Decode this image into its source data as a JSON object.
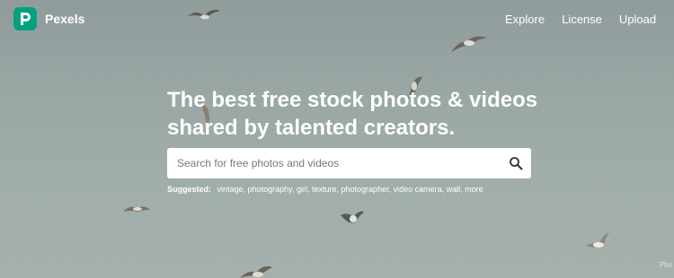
{
  "brand": {
    "name": "Pexels",
    "logo_letter_icon": "pexels-p-icon",
    "accent_color": "#05a081"
  },
  "nav": {
    "links": [
      "Explore",
      "License",
      "Upload"
    ],
    "more_label": "•••"
  },
  "hero": {
    "headline": "The best free stock photos & videos shared by talented creators.",
    "background_color": "#9aa7a5"
  },
  "search": {
    "placeholder": "Search for free photos and videos",
    "value": "",
    "icon": "search-icon"
  },
  "suggested": {
    "label": "Suggested:",
    "items": [
      "vintage,",
      "photography,",
      "girl,",
      "texture,",
      "photographer,",
      "video camera,",
      "wall,",
      "more"
    ]
  },
  "credit": {
    "text": "Pho"
  }
}
